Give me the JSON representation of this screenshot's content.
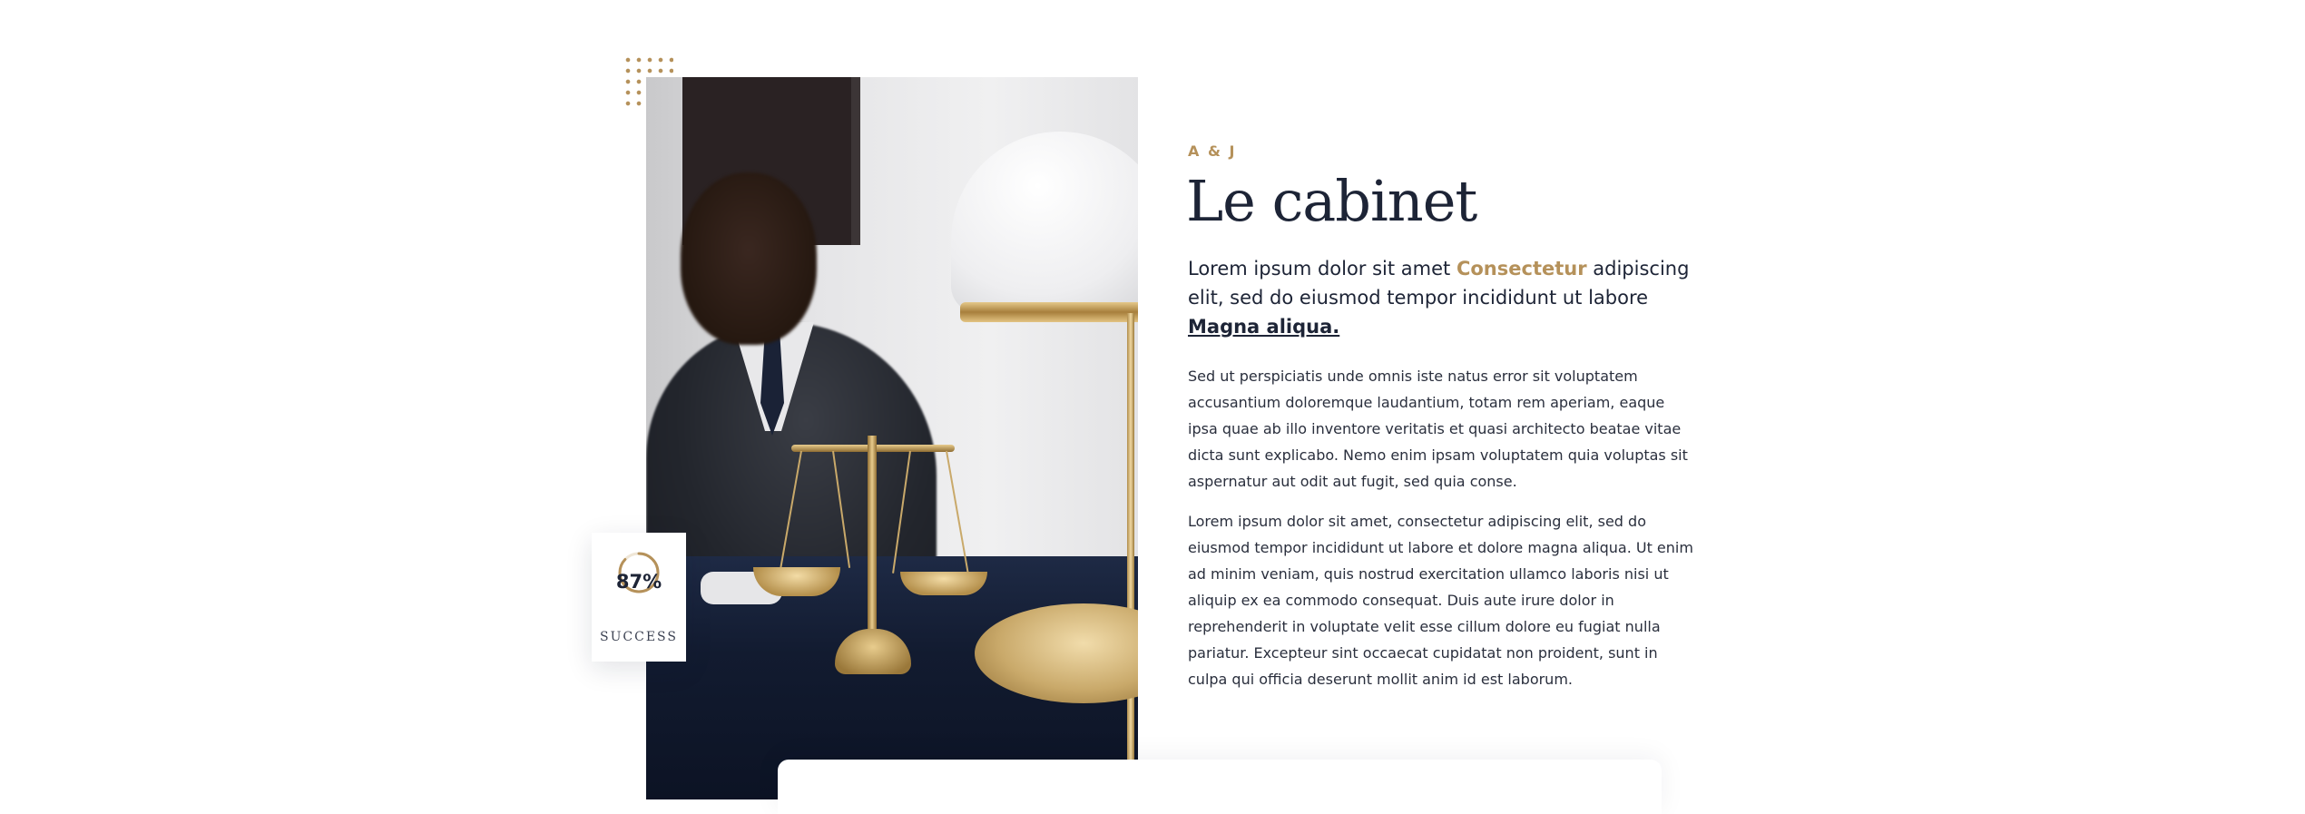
{
  "about": {
    "eyebrow": "A & J",
    "title": "Le cabinet",
    "lead_part1": "Lorem ipsum dolor sit amet ",
    "lead_highlight": "Consectetur",
    "lead_part2": " adipiscing elit, sed do eiusmod tempor incididunt ut labore ",
    "lead_link": "Magna aliqua.",
    "paragraph1": "Sed ut perspiciatis unde omnis iste natus error sit voluptatem accusantium doloremque laudantium, totam rem aperiam, eaque ipsa quae ab illo inventore veritatis et quasi architecto beatae vitae dicta sunt explicabo. Nemo enim ipsam voluptatem quia voluptas sit aspernatur aut odit aut fugit, sed quia conse.",
    "paragraph2": "Lorem ipsum dolor sit amet, consectetur adipiscing elit, sed do eiusmod tempor incididunt ut labore et dolore magna aliqua. Ut enim ad minim veniam, quis nostrud exercitation ullamco laboris nisi ut aliquip ex ea commodo consequat. Duis aute irure dolor in reprehenderit in voluptate velit esse cillum dolore eu fugiat nulla pariatur. Excepteur sint occaecat cupidatat non proident, sunt in culpa qui officia deserunt mollit anim id est laborum."
  },
  "badge": {
    "value": "87%",
    "fraction": 0.87,
    "label": "SUCCESS"
  },
  "colors": {
    "accent": "#b5915a",
    "navy": "#1d2436"
  }
}
